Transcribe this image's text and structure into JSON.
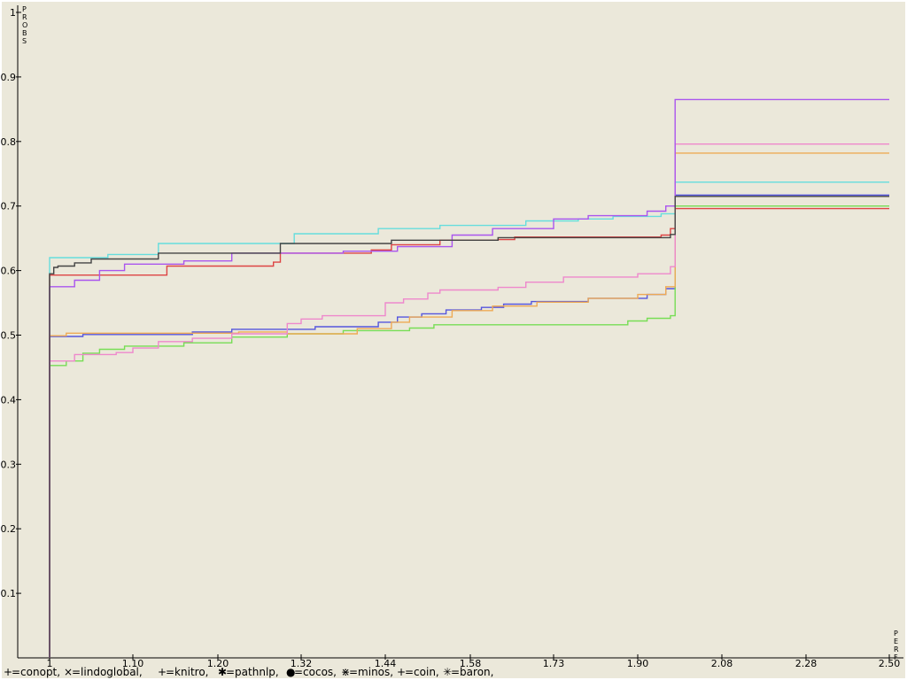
{
  "chart_data": {
    "type": "line",
    "title": "",
    "xlabel": "PERF",
    "ylabel": "PROBS",
    "xlim": [
      1,
      2.5
    ],
    "ylim": [
      0,
      1
    ],
    "x_tick_labels": [
      "1",
      "1.10",
      "1.20",
      "1.32",
      "1.44",
      "1.58",
      "1.73",
      "1.90",
      "2.08",
      "2.28",
      "2.50"
    ],
    "y_tick_labels": [
      "0.1",
      "0.2",
      "0.3",
      "0.4",
      "0.5",
      "0.6",
      "0.7",
      "0.8",
      "0.9",
      "1"
    ],
    "x_tick_values": [
      1,
      1.1,
      1.2,
      1.32,
      1.44,
      1.58,
      1.73,
      1.9,
      2.08,
      2.28,
      2.5
    ],
    "y_tick_values": [
      0.1,
      0.2,
      0.3,
      0.4,
      0.5,
      0.6,
      0.7,
      0.8,
      0.9,
      1
    ],
    "grid": false,
    "legend_position": "bottom-left",
    "series": [
      {
        "name": "conopt",
        "legend_label": "=conopt,",
        "color": "#5555dd",
        "marker": "+",
        "points": [
          [
            1,
            0
          ],
          [
            1,
            0.498
          ],
          [
            1.04,
            0.501
          ],
          [
            1.17,
            0.505
          ],
          [
            1.22,
            0.509
          ],
          [
            1.34,
            0.513
          ],
          [
            1.43,
            0.52
          ],
          [
            1.46,
            0.528
          ],
          [
            1.5,
            0.533
          ],
          [
            1.54,
            0.539
          ],
          [
            1.6,
            0.543
          ],
          [
            1.64,
            0.548
          ],
          [
            1.69,
            0.552
          ],
          [
            1.8,
            0.557
          ],
          [
            1.92,
            0.563
          ],
          [
            1.96,
            0.572
          ],
          [
            1.98,
            0.717
          ],
          [
            2.5,
            0.717
          ]
        ]
      },
      {
        "name": "lindoglobal",
        "legend_label": "=lindoglobal,",
        "color": "#66dddd",
        "marker": "×",
        "points": [
          [
            1,
            0
          ],
          [
            1,
            0.62
          ],
          [
            1.07,
            0.625
          ],
          [
            1.13,
            0.642
          ],
          [
            1.31,
            0.657
          ],
          [
            1.43,
            0.665
          ],
          [
            1.53,
            0.67
          ],
          [
            1.68,
            0.677
          ],
          [
            1.78,
            0.68
          ],
          [
            1.85,
            0.684
          ],
          [
            1.95,
            0.688
          ],
          [
            1.98,
            0.737
          ],
          [
            2.5,
            0.737
          ]
        ]
      },
      {
        "name": "knitro",
        "legend_label": "=knitro,",
        "color": "#77dd55",
        "marker": "+",
        "points": [
          [
            1,
            0
          ],
          [
            1,
            0.453
          ],
          [
            1.02,
            0.46
          ],
          [
            1.04,
            0.472
          ],
          [
            1.06,
            0.478
          ],
          [
            1.09,
            0.483
          ],
          [
            1.16,
            0.488
          ],
          [
            1.22,
            0.497
          ],
          [
            1.3,
            0.502
          ],
          [
            1.38,
            0.507
          ],
          [
            1.48,
            0.511
          ],
          [
            1.52,
            0.516
          ],
          [
            1.88,
            0.522
          ],
          [
            1.92,
            0.526
          ],
          [
            1.97,
            0.53
          ],
          [
            1.98,
            0.7
          ],
          [
            2.5,
            0.7
          ]
        ]
      },
      {
        "name": "pathnlp",
        "legend_label": "=pathnlp,",
        "color": "#eeaa55",
        "marker": "✱",
        "points": [
          [
            1,
            0
          ],
          [
            1,
            0.499
          ],
          [
            1.02,
            0.503
          ],
          [
            1.23,
            0.505
          ],
          [
            1.3,
            0.502
          ],
          [
            1.4,
            0.51
          ],
          [
            1.45,
            0.52
          ],
          [
            1.48,
            0.528
          ],
          [
            1.55,
            0.538
          ],
          [
            1.62,
            0.545
          ],
          [
            1.7,
            0.551
          ],
          [
            1.8,
            0.557
          ],
          [
            1.9,
            0.563
          ],
          [
            1.96,
            0.575
          ],
          [
            1.98,
            0.782
          ],
          [
            2.5,
            0.782
          ]
        ]
      },
      {
        "name": "cocos",
        "legend_label": "=cocos,",
        "color": "#dd4444",
        "marker": "●",
        "points": [
          [
            1,
            0
          ],
          [
            1,
            0.593
          ],
          [
            1.14,
            0.607
          ],
          [
            1.28,
            0.613
          ],
          [
            1.29,
            0.627
          ],
          [
            1.35,
            0.627
          ],
          [
            1.42,
            0.632
          ],
          [
            1.45,
            0.64
          ],
          [
            1.53,
            0.647
          ],
          [
            1.63,
            0.648
          ],
          [
            1.66,
            0.652
          ],
          [
            1.95,
            0.655
          ],
          [
            1.97,
            0.665
          ],
          [
            1.98,
            0.696
          ],
          [
            2.5,
            0.696
          ]
        ]
      },
      {
        "name": "minos",
        "legend_label": "=minos,",
        "color": "#ee88cc",
        "marker": "⋇",
        "points": [
          [
            1,
            0
          ],
          [
            1,
            0.46
          ],
          [
            1.03,
            0.47
          ],
          [
            1.08,
            0.473
          ],
          [
            1.1,
            0.48
          ],
          [
            1.13,
            0.49
          ],
          [
            1.17,
            0.495
          ],
          [
            1.22,
            0.502
          ],
          [
            1.3,
            0.518
          ],
          [
            1.32,
            0.525
          ],
          [
            1.35,
            0.53
          ],
          [
            1.44,
            0.55
          ],
          [
            1.47,
            0.556
          ],
          [
            1.51,
            0.565
          ],
          [
            1.53,
            0.57
          ],
          [
            1.63,
            0.574
          ],
          [
            1.68,
            0.582
          ],
          [
            1.75,
            0.59
          ],
          [
            1.9,
            0.595
          ],
          [
            1.97,
            0.606
          ],
          [
            1.98,
            0.796
          ],
          [
            2.5,
            0.796
          ]
        ]
      },
      {
        "name": "coin",
        "legend_label": "=coin,",
        "color": "#aa55ee",
        "marker": "+",
        "points": [
          [
            1,
            0
          ],
          [
            1,
            0.575
          ],
          [
            1.03,
            0.585
          ],
          [
            1.06,
            0.6
          ],
          [
            1.09,
            0.61
          ],
          [
            1.16,
            0.615
          ],
          [
            1.22,
            0.627
          ],
          [
            1.38,
            0.63
          ],
          [
            1.46,
            0.637
          ],
          [
            1.55,
            0.655
          ],
          [
            1.62,
            0.665
          ],
          [
            1.73,
            0.68
          ],
          [
            1.8,
            0.685
          ],
          [
            1.92,
            0.692
          ],
          [
            1.96,
            0.7
          ],
          [
            1.98,
            0.865
          ],
          [
            2.5,
            0.865
          ]
        ]
      },
      {
        "name": "baron",
        "legend_label": "=baron,",
        "color": "#444444",
        "marker": "✳",
        "points": [
          [
            1,
            0
          ],
          [
            1,
            0.595
          ],
          [
            1.005,
            0.605
          ],
          [
            1.01,
            0.607
          ],
          [
            1.03,
            0.612
          ],
          [
            1.05,
            0.618
          ],
          [
            1.13,
            0.627
          ],
          [
            1.29,
            0.642
          ],
          [
            1.45,
            0.647
          ],
          [
            1.63,
            0.651
          ],
          [
            1.97,
            0.656
          ],
          [
            1.98,
            0.715
          ],
          [
            2.5,
            0.715
          ]
        ]
      }
    ]
  }
}
